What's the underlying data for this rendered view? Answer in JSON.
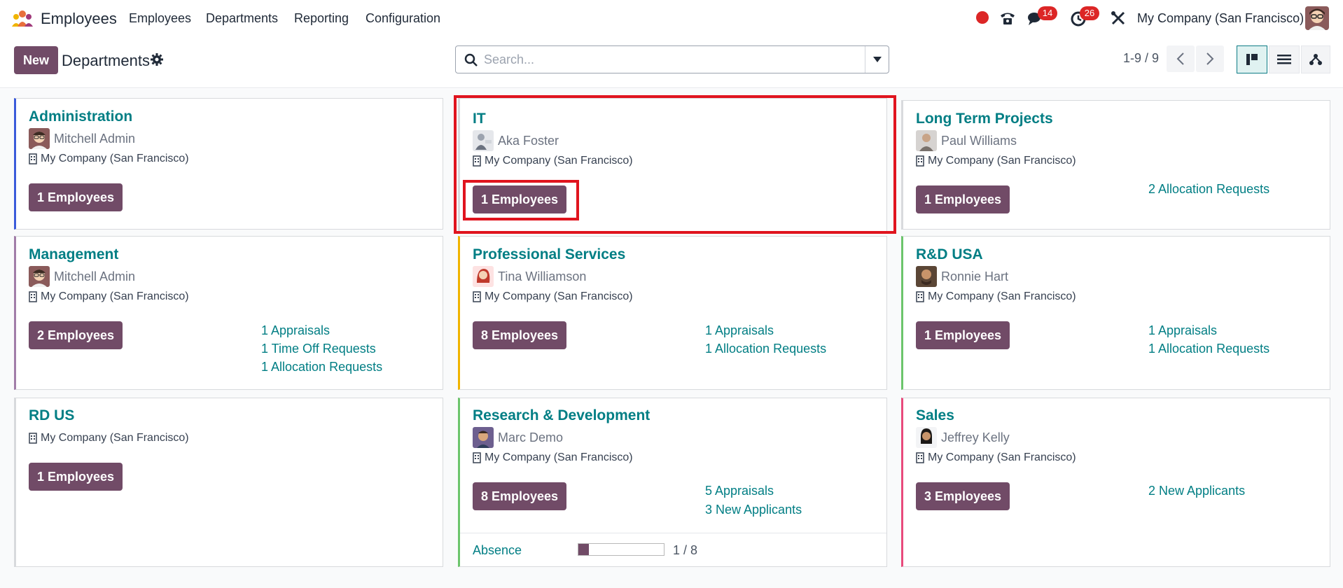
{
  "navbar": {
    "app_name": "Employees",
    "menu": [
      "Employees",
      "Departments",
      "Reporting",
      "Configuration"
    ],
    "messages_badge": "14",
    "activities_badge": "26",
    "company": "My Company (San Francisco)"
  },
  "control_panel": {
    "new_label": "New",
    "breadcrumb": "Departments",
    "search_placeholder": "Search...",
    "pager": "1-9 / 9"
  },
  "departments": [
    {
      "name": "Administration",
      "manager": "Mitchell Admin",
      "company": "My Company (San Francisco)",
      "employees": "1 Employees",
      "links": [],
      "color": "#3b5bdb"
    },
    {
      "name": "IT",
      "manager": "Aka Foster",
      "company": "My Company (San Francisco)",
      "employees": "1 Employees",
      "links": [],
      "color": "#d8dadd"
    },
    {
      "name": "Long Term Projects",
      "manager": "Paul Williams",
      "company": "My Company (San Francisco)",
      "employees": "1 Employees",
      "links": [
        "2 Allocation Requests"
      ],
      "color": "#d8dadd"
    },
    {
      "name": "Management",
      "manager": "Mitchell Admin",
      "company": "My Company (San Francisco)",
      "employees": "2 Employees",
      "links": [
        "1 Appraisals",
        "1 Time Off Requests",
        "1 Allocation Requests"
      ],
      "color": "#a17da8"
    },
    {
      "name": "Professional Services",
      "manager": "Tina Williamson",
      "company": "My Company (San Francisco)",
      "employees": "8 Employees",
      "links": [
        "1 Appraisals",
        "1 Allocation Requests"
      ],
      "color": "#f0b400"
    },
    {
      "name": "R&D USA",
      "manager": "Ronnie Hart",
      "company": "My Company (San Francisco)",
      "employees": "1 Employees",
      "links": [
        "1 Appraisals",
        "1 Allocation Requests"
      ],
      "color": "#6cc56c"
    },
    {
      "name": "RD US",
      "manager": "",
      "company": "My Company (San Francisco)",
      "employees": "1 Employees",
      "links": [],
      "color": "#d8dadd"
    },
    {
      "name": "Research & Development",
      "manager": "Marc Demo",
      "company": "My Company (San Francisco)",
      "employees": "8 Employees",
      "links": [
        "5 Appraisals",
        "3 New Applicants"
      ],
      "color": "#6cc56c",
      "absence": {
        "label": "Absence",
        "text": "1 / 8",
        "fraction": 0.125
      }
    },
    {
      "name": "Sales",
      "manager": "Jeffrey Kelly",
      "company": "My Company (San Francisco)",
      "employees": "3 Employees",
      "links": [
        "2 New Applicants"
      ],
      "color": "#e84a7c"
    }
  ],
  "icons": {
    "app_logo": "app-logo-icon",
    "settings": "gear-icon",
    "search": "search-icon",
    "phone": "phone-icon",
    "chat": "chat-icon",
    "activity": "clock-icon",
    "debug": "tools-icon"
  },
  "colors": {
    "accent": "#714b67",
    "link": "#017e84",
    "highlight": "#e0141e",
    "badge": "#dc2626"
  }
}
